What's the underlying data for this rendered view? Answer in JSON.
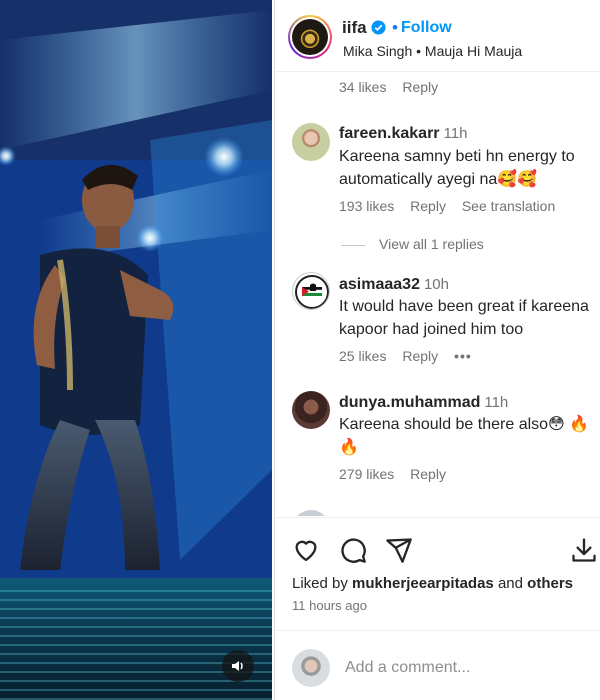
{
  "post": {
    "username": "iifa",
    "follow_label": "Follow",
    "dot": "•",
    "audio": "Mika Singh • Mauja Hi Mauja"
  },
  "top_partial": {
    "likes": "34 likes",
    "reply": "Reply"
  },
  "comments": [
    {
      "username": "fareen.kakarr",
      "time": "11h",
      "text_line1": "Kareena samny beti hn energy to",
      "text_line2": "automatically ayegi na🥰🥰",
      "likes": "193 likes",
      "reply": "Reply",
      "see_translation": "See translation",
      "view_replies": "View all 1 replies"
    },
    {
      "username": "asimaaa32",
      "time": "10h",
      "text_line1": "It would have been great if kareena",
      "text_line2": "kapoor had joined him too",
      "likes": "25 likes",
      "reply": "Reply",
      "more": "•••"
    },
    {
      "username": "dunya.muhammad",
      "time": "11h",
      "text_line1": "Kareena should be there also😳 🔥",
      "text_line2": "🔥",
      "likes": "279 likes",
      "reply": "Reply"
    }
  ],
  "liked_by": {
    "prefix": "Liked by ",
    "user": "mukherjeearpitadas",
    "middle": " and ",
    "others": "others"
  },
  "time_ago": "11 hours ago",
  "add_comment": {
    "placeholder": "Add a comment..."
  },
  "colors": {
    "accent": "#0095f6",
    "verified": "#0095f6",
    "muted": "#737373",
    "text": "#262626"
  },
  "icons": [
    "speaker-icon",
    "verified-badge-icon",
    "heart-icon",
    "comment-icon",
    "share-icon",
    "download-icon"
  ]
}
